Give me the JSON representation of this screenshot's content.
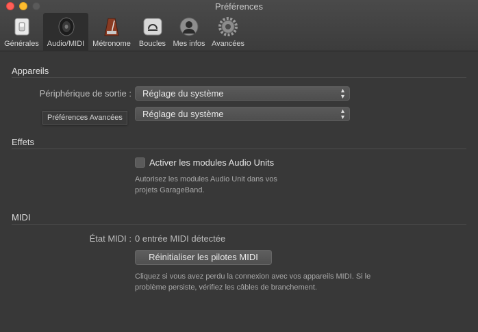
{
  "window": {
    "title": "Préférences"
  },
  "toolbar": {
    "tabs": [
      {
        "label": "Générales",
        "icon": "switch-icon",
        "active": false
      },
      {
        "label": "Audio/MIDI",
        "icon": "speaker-icon",
        "active": true
      },
      {
        "label": "Métronome",
        "icon": "metronome-icon",
        "active": false
      },
      {
        "label": "Boucles",
        "icon": "loop-icon",
        "active": false
      },
      {
        "label": "Mes infos",
        "icon": "user-icon",
        "active": false
      },
      {
        "label": "Avancées",
        "icon": "gear-icon",
        "active": false
      }
    ]
  },
  "devices": {
    "title": "Appareils",
    "output_label": "Périphérique de sortie :",
    "output_value": "Réglage du système",
    "input_value": "Réglage du système",
    "tooltip": "Préférences Avancées"
  },
  "effects": {
    "title": "Effets",
    "checkbox_label": "Activer les modules Audio Units",
    "help": "Autorisez les modules Audio Unit dans vos projets GarageBand.",
    "help_line1": "Autorisez les modules Audio Unit dans vos",
    "help_line2": "projets GarageBand."
  },
  "midi": {
    "title": "MIDI",
    "status_label": "État MIDI :",
    "status_value": "0 entrée MIDI détectée",
    "reset_button": "Réinitialiser les pilotes MIDI",
    "help_line1": "Cliquez si vous avez perdu la connexion avec vos appareils MIDI. Si le",
    "help_line2": "problème persiste, vérifiez les câbles de branchement."
  }
}
